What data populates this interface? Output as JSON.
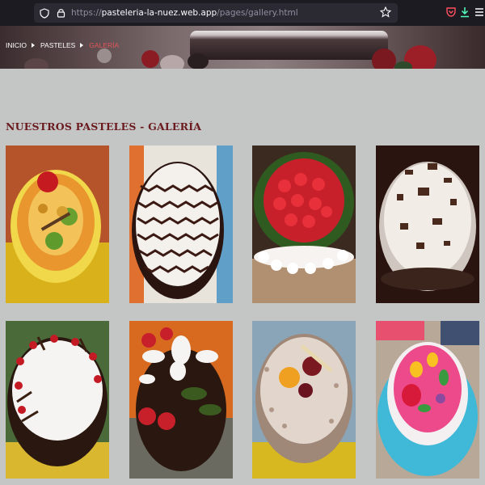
{
  "browser": {
    "url_scheme": "https://",
    "url_host": "pasteleria-la-nuez.web.app",
    "url_path": "/pages/gallery.html",
    "icons": [
      "shield-icon",
      "lock-icon",
      "bookmark-star-icon",
      "pocket-icon",
      "download-icon",
      "menu-icon"
    ]
  },
  "breadcrumb": {
    "items": [
      "INICIO",
      "PASTELES"
    ],
    "current": "GALERÍA"
  },
  "page_title": "NUESTROS PASTELES - GALERÍA",
  "colors": {
    "page_bg": "#c4c6c6",
    "title": "#6b1a1e",
    "breadcrumb_current": "#e0565c",
    "browser_bar": "#1c1b22"
  },
  "gallery": [
    {
      "name": "fruit-cake-photo"
    },
    {
      "name": "chocolate-zigzag-cake-photo"
    },
    {
      "name": "strawberry-cake-photo"
    },
    {
      "name": "chocolate-chips-cream-cake-photo"
    },
    {
      "name": "black-forest-cake-photo"
    },
    {
      "name": "chocolate-flowers-cake-photo"
    },
    {
      "name": "peach-cream-cake-photo"
    },
    {
      "name": "jelly-flower-cake-photo"
    }
  ]
}
